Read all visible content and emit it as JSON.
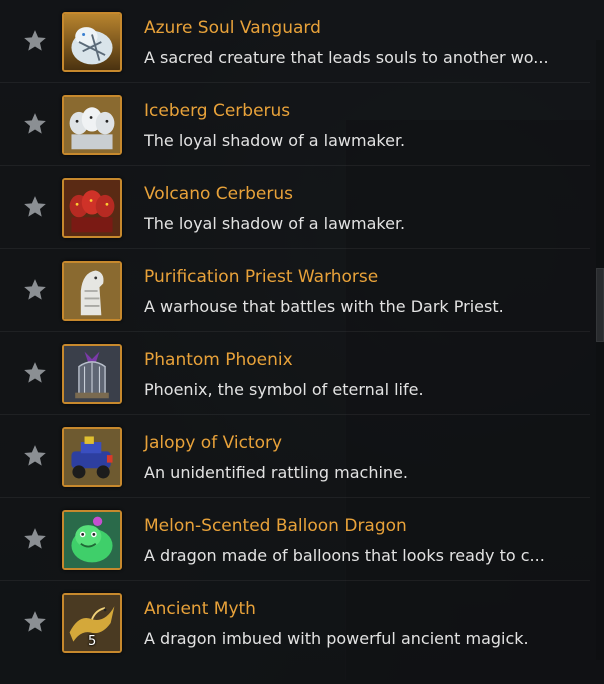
{
  "colors": {
    "name": "#e8a23a",
    "description": "#e2e2e2",
    "icon_frame": "#c7892d",
    "star": "#8b8f93"
  },
  "items": [
    {
      "name": "Azure Soul Vanguard",
      "description": "A sacred creature that leads souls to another wo...",
      "icon": "white-tiger-mount-icon"
    },
    {
      "name": "Iceberg Cerberus",
      "description": "The loyal shadow of a lawmaker.",
      "icon": "white-cerberus-icon"
    },
    {
      "name": "Volcano Cerberus",
      "description": "The loyal shadow of a lawmaker.",
      "icon": "red-cerberus-icon"
    },
    {
      "name": "Purification Priest Warhorse",
      "description": "A warhouse that battles with the Dark Priest.",
      "icon": "white-warhorse-icon"
    },
    {
      "name": "Phantom Phoenix",
      "description": "Phoenix, the symbol of eternal life.",
      "icon": "phoenix-cage-icon"
    },
    {
      "name": "Jalopy of Victory",
      "description": "An unidentified rattling machine.",
      "icon": "jalopy-car-icon"
    },
    {
      "name": "Melon-Scented Balloon Dragon",
      "description": "A dragon made of balloons that looks ready to c...",
      "icon": "balloon-dragon-icon"
    },
    {
      "name": "Ancient Myth",
      "description": "A dragon imbued with powerful ancient magick.",
      "icon": "golden-dragon-icon",
      "quantity": "5"
    }
  ]
}
